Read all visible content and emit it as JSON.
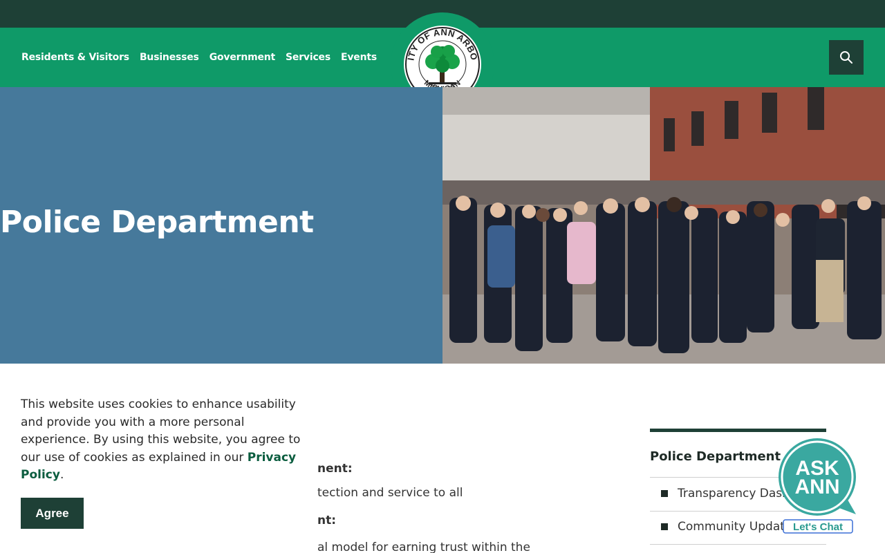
{
  "nav": {
    "items": [
      "Residents & Visitors",
      "Businesses",
      "Government",
      "Services",
      "Events"
    ]
  },
  "logo": {
    "top_text": "CITY OF ANN ARBOR",
    "bottom_text": "MICHIGAN",
    "alt": "City of Ann Arbor Michigan seal"
  },
  "search": {
    "icon": "search-icon"
  },
  "hero": {
    "title": "Police Department",
    "background_color": "#46799b"
  },
  "content": {
    "lines": [
      "nent:",
      "tection and service to all",
      "nt:",
      "al model for earning trust within the"
    ]
  },
  "sidebar": {
    "title": "Police Department",
    "items": [
      "Transparency Dash",
      "Community Update"
    ]
  },
  "cookie": {
    "text_before": "This website uses cookies to enhance usability and provide you with a more personal experience. By using this website, you agree to our use of cookies as explained in our ",
    "link": "Privacy Policy",
    "text_after": ".",
    "agree_label": "Agree"
  },
  "chat": {
    "line1": "ASK",
    "line2": "ANN",
    "cta": "Let's Chat"
  },
  "colors": {
    "brand_green": "#0f9a68",
    "dark_green": "#1e4036",
    "link_green": "#0b5d3f",
    "chat_teal": "#3aa8a0"
  }
}
